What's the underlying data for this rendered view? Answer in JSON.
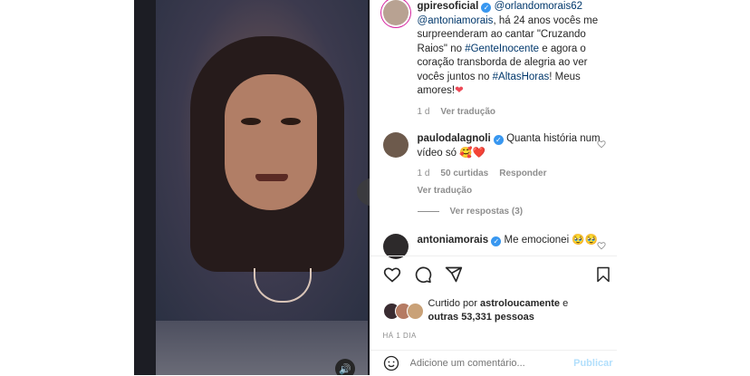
{
  "caption": {
    "username": "gpiresoficial",
    "mention1": "@orlandomorais62",
    "mention2": "@antoniamorais",
    "text_a": ", há 24 anos vocês me surpreenderam ao cantar \"Cruzando Raios\" no ",
    "hashtag1": "#GenteInocente",
    "text_b": " e agora o coração transborda de alegria ao ver vocês juntos no ",
    "hashtag2": "#AltasHoras",
    "text_c": "! Meus amores!",
    "time": "1 d",
    "translate": "Ver tradução"
  },
  "comments": [
    {
      "username": "paulodalagnoli",
      "text": "Quanta história num vídeo só",
      "emoji": "🥰❤️",
      "time": "1 d",
      "likes": "50 curtidas",
      "reply": "Responder",
      "translate": "Ver tradução",
      "replies": "Ver respostas (3)"
    },
    {
      "username": "antoniamorais",
      "text": "Me emocionei",
      "emoji": "🥹🥹"
    }
  ],
  "likes": {
    "prefix": "Curtido por",
    "user": "astroloucamente",
    "joiner": " e",
    "others": "outras 53,331 pessoas"
  },
  "posted_ago": "HÁ 1 DIA",
  "comment_input": {
    "placeholder": "Adicione um comentário..."
  },
  "publish_label": "Publicar",
  "icons": {
    "verified": "verified-badge-icon",
    "heart": "heart-icon",
    "comment": "comment-icon",
    "share": "share-icon",
    "save": "bookmark-icon",
    "emoji": "emoji-icon",
    "sound": "speaker-icon"
  },
  "colors": {
    "accent": "#3897f0",
    "link": "#00376b",
    "like": "#ed4956",
    "muted": "#8e8e8e"
  }
}
